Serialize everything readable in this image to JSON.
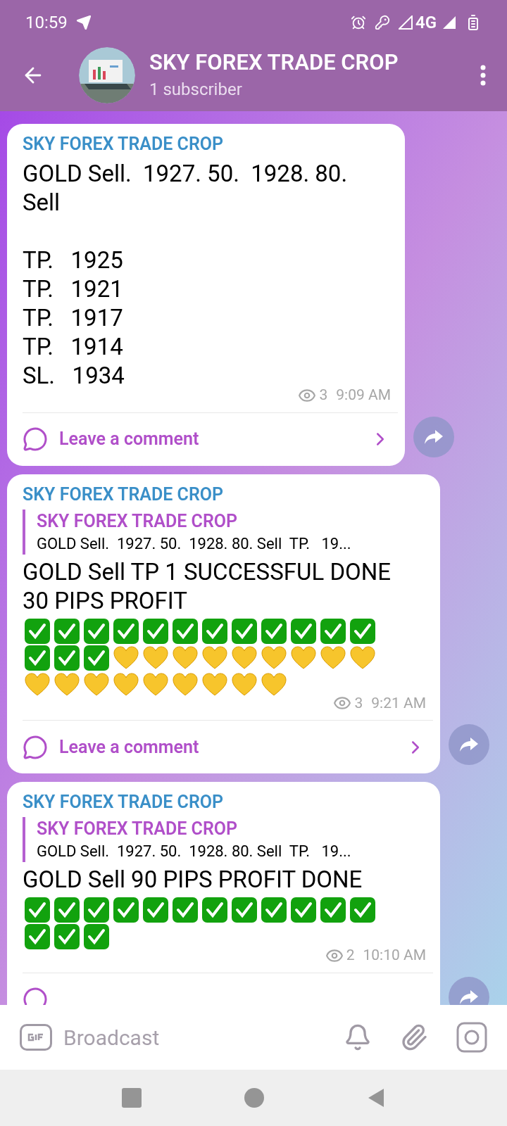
{
  "status_bar": {
    "time": "10:59",
    "network": "4G"
  },
  "header": {
    "title": "SKY FOREX TRADE CROP",
    "subtitle": "1 subscriber"
  },
  "messages": [
    {
      "sender": "SKY FOREX TRADE CROP",
      "paragraphs": [
        [
          "GOLD Sell.  1927. 50.  1928. 80. Sell"
        ],
        [
          "TP.   1925",
          "TP.   1921",
          "TP.   1917",
          "TP.   1914",
          "SL.   1934"
        ]
      ],
      "views": "3",
      "time": "9:09 AM",
      "comment": "Leave a comment"
    },
    {
      "sender": "SKY FOREX TRADE CROP",
      "reply": {
        "sender": "SKY FOREX TRADE CROP",
        "text": "GOLD Sell.  1927. 50.  1928. 80. Sell  TP.   19..."
      },
      "paragraphs": [
        [
          "GOLD Sell TP 1 SUCCESSFUL DONE 30 PIPS PROFIT"
        ]
      ],
      "emojis": [
        {
          "kind": "check"
        },
        {
          "kind": "check"
        },
        {
          "kind": "check"
        },
        {
          "kind": "check"
        },
        {
          "kind": "check"
        },
        {
          "kind": "check"
        },
        {
          "kind": "check"
        },
        {
          "kind": "check"
        },
        {
          "kind": "check"
        },
        {
          "kind": "check"
        },
        {
          "kind": "check"
        },
        {
          "kind": "check"
        },
        {
          "kind": "check"
        },
        {
          "kind": "check"
        },
        {
          "kind": "check"
        },
        {
          "kind": "heart"
        },
        {
          "kind": "heart"
        },
        {
          "kind": "heart"
        },
        {
          "kind": "heart"
        },
        {
          "kind": "heart"
        },
        {
          "kind": "heart"
        },
        {
          "kind": "heart"
        },
        {
          "kind": "heart"
        },
        {
          "kind": "heart"
        },
        {
          "kind": "heart"
        },
        {
          "kind": "heart"
        },
        {
          "kind": "heart"
        },
        {
          "kind": "heart"
        },
        {
          "kind": "heart"
        },
        {
          "kind": "heart"
        },
        {
          "kind": "heart"
        },
        {
          "kind": "heart"
        },
        {
          "kind": "heart"
        }
      ],
      "views": "3",
      "time": "9:21 AM",
      "comment": "Leave a comment"
    },
    {
      "sender": "SKY FOREX TRADE CROP",
      "reply": {
        "sender": "SKY FOREX TRADE CROP",
        "text": "GOLD Sell.  1927. 50.  1928. 80. Sell  TP.   19..."
      },
      "paragraphs": [
        [
          "GOLD Sell 90 PIPS PROFIT DONE"
        ]
      ],
      "emojis": [
        {
          "kind": "check"
        },
        {
          "kind": "check"
        },
        {
          "kind": "check"
        },
        {
          "kind": "check"
        },
        {
          "kind": "check"
        },
        {
          "kind": "check"
        },
        {
          "kind": "check"
        },
        {
          "kind": "check"
        },
        {
          "kind": "check"
        },
        {
          "kind": "check"
        },
        {
          "kind": "check"
        },
        {
          "kind": "check"
        },
        {
          "kind": "check"
        },
        {
          "kind": "check"
        },
        {
          "kind": "check"
        }
      ],
      "views": "2",
      "time": "10:10 AM"
    }
  ],
  "composer": {
    "placeholder": "Broadcast"
  }
}
